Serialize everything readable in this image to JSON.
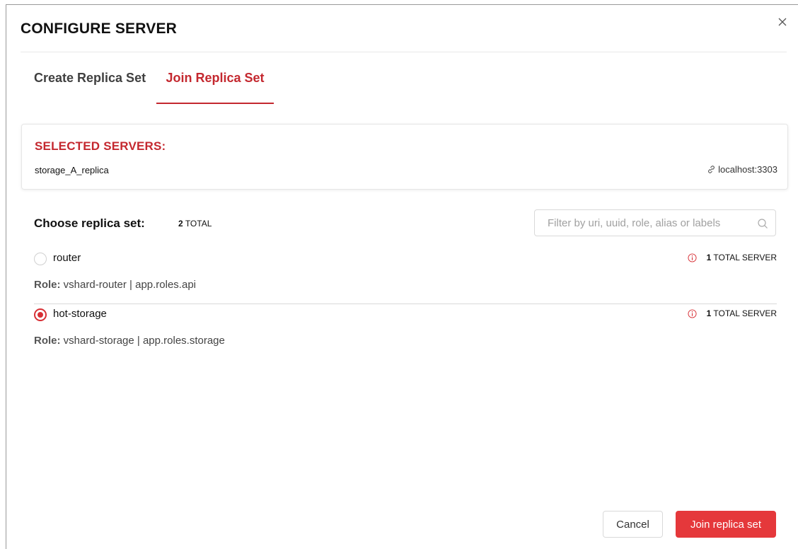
{
  "dialog": {
    "title": "CONFIGURE SERVER",
    "close_icon": "close-icon"
  },
  "tabs": [
    {
      "label": "Create Replica Set",
      "active": false
    },
    {
      "label": "Join Replica Set",
      "active": true
    }
  ],
  "selected_servers": {
    "title": "SELECTED SERVERS:",
    "server_alias": "storage_A_replica",
    "uri": "localhost:3303",
    "uri_icon": "link-icon"
  },
  "replica_sets": {
    "heading": "Choose replica set:",
    "total_count": "2",
    "total_label": "TOTAL",
    "filter_placeholder": "Filter by uri, uuid, role, alias or labels",
    "search_icon": "search-icon",
    "items": [
      {
        "name": "router",
        "selected": false,
        "role_label": "Role:",
        "roles": "vshard-router | app.roles.api",
        "server_count": "1",
        "server_count_label": "TOTAL SERVER"
      },
      {
        "name": "hot-storage",
        "selected": true,
        "role_label": "Role:",
        "roles": "vshard-storage | app.roles.storage",
        "server_count": "1",
        "server_count_label": "TOTAL SERVER"
      }
    ]
  },
  "footer": {
    "cancel_label": "Cancel",
    "join_label": "Join replica set"
  },
  "colors": {
    "accent": "#c4282f",
    "primary_button": "#e5383b"
  }
}
